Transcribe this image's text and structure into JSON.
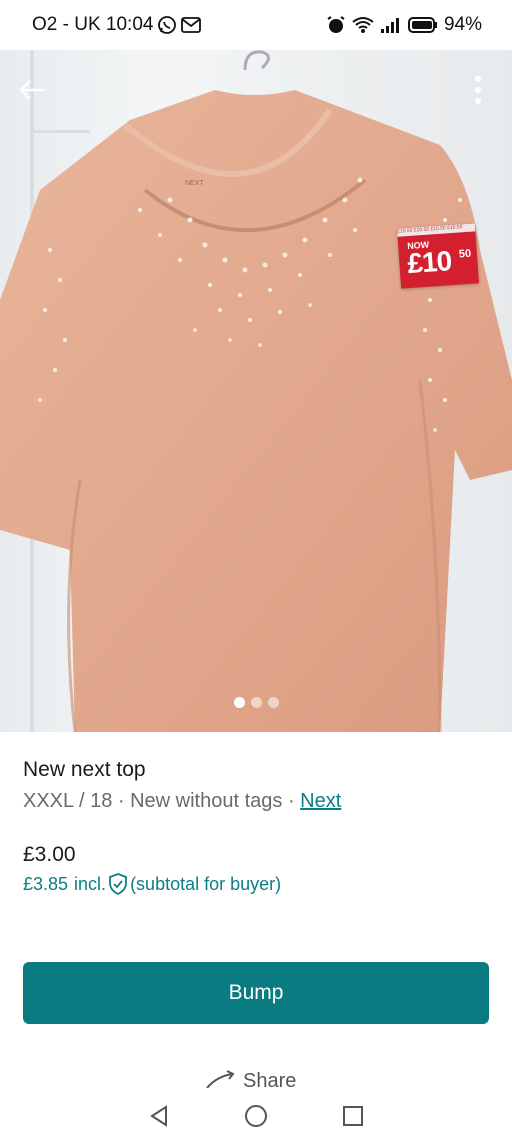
{
  "status_bar": {
    "carrier_time": "O2 - UK 10:04",
    "battery": "94%"
  },
  "photo": {
    "carousel_total": 3,
    "carousel_active": 1,
    "tag": {
      "now": "NOW",
      "price": "£10",
      "cents": "50"
    }
  },
  "item": {
    "title": "New next top",
    "size_condition": "XXXL / 18 · New without tags · ",
    "brand": "Next",
    "price": "£3.00",
    "buyer_price": "£3.85",
    "incl": "incl.",
    "subtotal_note": "(subtotal for buyer)"
  },
  "actions": {
    "bump": "Bump",
    "share": "Share"
  },
  "colors": {
    "accent": "#0a7b80",
    "link": "#0a7f86",
    "tag_red": "#d2202f"
  }
}
